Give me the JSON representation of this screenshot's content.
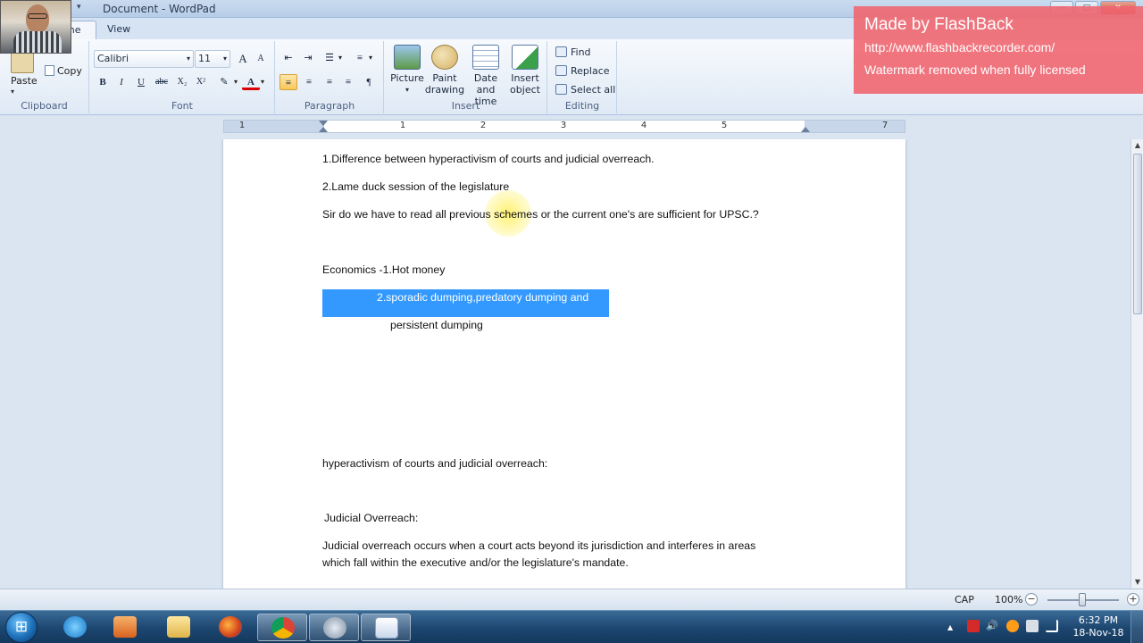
{
  "window": {
    "title": "Document - WordPad",
    "minimize_glyph": "—",
    "maximize_glyph": "□",
    "close_glyph": "✕"
  },
  "tabs": [
    {
      "label": "me"
    },
    {
      "label": "View"
    }
  ],
  "clipboard": {
    "paste": "Paste",
    "copy": "Copy",
    "group": "Clipboard"
  },
  "font": {
    "family": "Calibri",
    "size": "11",
    "group": "Font",
    "bold": "B",
    "italic": "I",
    "underline": "U",
    "strike": "abc",
    "subscript": "X₂",
    "superscript": "X²",
    "grow": "A",
    "shrink": "A",
    "color_letter": "A"
  },
  "paragraph": {
    "group": "Paragraph"
  },
  "insert": {
    "group": "Insert",
    "picture": "Picture",
    "paint": "Paint drawing",
    "datetime": "Date and time",
    "object": "Insert object"
  },
  "editing": {
    "group": "Editing",
    "find": "Find",
    "replace": "Replace",
    "select_all": "Select all"
  },
  "ruler": {
    "numbers": [
      "1",
      "1",
      "2",
      "3",
      "4",
      "5",
      "7"
    ]
  },
  "document": {
    "line1": "1.Difference between hyperactivism of courts and judicial overreach.",
    "line2": "2.Lame duck session of the legislature",
    "line3": "Sir do we have to read all previous schemes or the current one's are sufficient for UPSC.?",
    "line4": "Economics -1.Hot money",
    "line5": "2.sporadic dumping,predatory dumping and",
    "line6": "persistent dumping",
    "line7": "hyperactivism of courts and judicial overreach:",
    "line8": "Judicial Overreach:",
    "line9": "Judicial overreach occurs when a court acts beyond its jurisdiction and interferes in areas",
    "line10": "which fall within the executive and/or the legislature's mandate."
  },
  "status": {
    "cap": "CAP",
    "zoom": "100%",
    "zoom_level": 1.0
  },
  "taskbar": {
    "time": "6:32 PM",
    "date": "18-Nov-18"
  },
  "watermark": {
    "line1": "Made by FlashBack",
    "line2": "http://www.flashbackrecorder.com/",
    "line3": "Watermark removed when fully licensed"
  },
  "colors": {
    "selection": "#3399ff",
    "watermark": "#ef6670",
    "ribbon": "#dfe9f5"
  }
}
